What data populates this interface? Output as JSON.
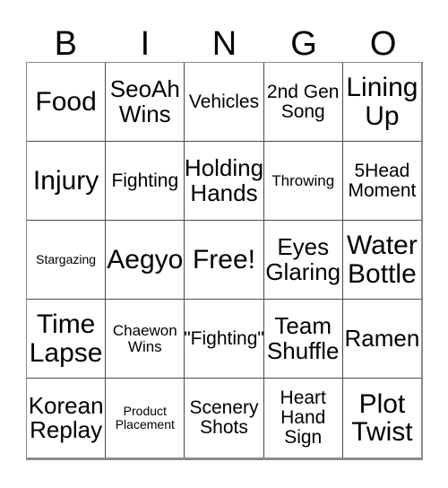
{
  "card": {
    "headers": [
      "B",
      "I",
      "N",
      "G",
      "O"
    ],
    "rows": [
      [
        {
          "text": "Food",
          "size": "s-xl"
        },
        {
          "text": "SeoAh Wins",
          "size": "s-lg"
        },
        {
          "text": "Vehicles",
          "size": "s-md"
        },
        {
          "text": "2nd Gen Song",
          "size": "s-md"
        },
        {
          "text": "Lining Up",
          "size": "s-xl"
        }
      ],
      [
        {
          "text": "Injury",
          "size": "s-xl"
        },
        {
          "text": "Fighting",
          "size": "s-md"
        },
        {
          "text": "Holding Hands",
          "size": "s-lg"
        },
        {
          "text": "Throwing",
          "size": "s-sm"
        },
        {
          "text": "5Head Moment",
          "size": "s-md"
        }
      ],
      [
        {
          "text": "Stargazing",
          "size": "s-xs"
        },
        {
          "text": "Aegyo",
          "size": "s-xl"
        },
        {
          "text": "Free!",
          "size": "s-xl"
        },
        {
          "text": "Eyes Glaring",
          "size": "s-lg"
        },
        {
          "text": "Water Bottle",
          "size": "s-xl"
        }
      ],
      [
        {
          "text": "Time Lapse",
          "size": "s-xl"
        },
        {
          "text": "Chaewon Wins",
          "size": "s-sm"
        },
        {
          "text": "\"Fighting\"",
          "size": "s-md"
        },
        {
          "text": "Team Shuffle",
          "size": "s-lg"
        },
        {
          "text": "Ramen",
          "size": "s-lg"
        }
      ],
      [
        {
          "text": "Korean Replay",
          "size": "s-lg"
        },
        {
          "text": "Product Placement",
          "size": "s-xs"
        },
        {
          "text": "Scenery Shots",
          "size": "s-md"
        },
        {
          "text": "Heart Hand Sign",
          "size": "s-md"
        },
        {
          "text": "Plot Twist",
          "size": "s-xl"
        }
      ]
    ]
  },
  "colors": {
    "grid_line": "#4a4a4a",
    "outer_border": "#8a8a8a",
    "text": "#000000",
    "background": "#ffffff"
  }
}
